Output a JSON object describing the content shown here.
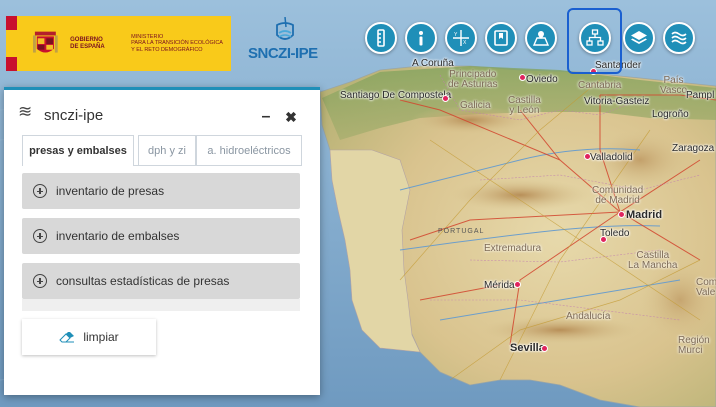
{
  "header": {
    "gov_logo": {
      "line1": "GOBIERNO\nDE ESPAÑA",
      "line2": "MINISTERIO\nPARA LA TRANSICIÓN ECOLÓGICA\nY EL RETO DEMOGRÁFICO"
    },
    "brand": "SNCZI-IPE",
    "toolbar": [
      {
        "name": "ruler-icon"
      },
      {
        "name": "info-icon"
      },
      {
        "name": "coordinates-icon"
      },
      {
        "name": "bookmark-icon"
      },
      {
        "name": "map-pin-icon"
      },
      {
        "name": "hierarchy-icon"
      },
      {
        "name": "layers-icon"
      },
      {
        "name": "waves-icon"
      }
    ]
  },
  "map": {
    "labels": {
      "a_coruna": "A Coruña",
      "oviedo": "Oviedo",
      "santander": "Santander",
      "principado": "Principado\nde Asturias",
      "cantabria": "Cantabria",
      "pais_vasco": "País\nVasco",
      "pamplona": "Pampl",
      "santiago": "Santiago De Compostela",
      "galicia": "Galicia",
      "castilla_leon": "Castilla\ny León",
      "vitoria": "Vitoria-Gasteiz",
      "logrono": "Logroño",
      "zaragoza": "Zaragoza",
      "valladolid": "Valladolid",
      "comunidad": "Comunidad\nde Madrid",
      "madrid": "Madrid",
      "portugal": "PORTUGAL",
      "toledo": "Toledo",
      "extremadura": "Extremadura",
      "castilla_mancha": "Castilla\nLa Mancha",
      "comunidad_valenciana": "Com\nVale",
      "merida": "Mérida",
      "andalucia": "Andalucía",
      "sevilla": "Sevilla",
      "region_murcia": "Región\nMurci"
    }
  },
  "panel": {
    "title": "snczi-ipe",
    "minimize": "–",
    "close": "✖",
    "tabs": [
      {
        "label": "presas y embalses",
        "active": true
      },
      {
        "label": "dph y zi",
        "active": false
      },
      {
        "label": "a. hidroeléctricos",
        "active": false
      }
    ],
    "sections": [
      {
        "label": "inventario de presas"
      },
      {
        "label": "inventario de embalses"
      },
      {
        "label": "consultas estadísticas de presas"
      }
    ],
    "clear_label": "limpiar"
  },
  "colors": {
    "accent": "#1f8fb8",
    "gov_yellow": "#f9ca1a",
    "gov_red": "#c8102e",
    "highlight": "#1a5fd0"
  }
}
